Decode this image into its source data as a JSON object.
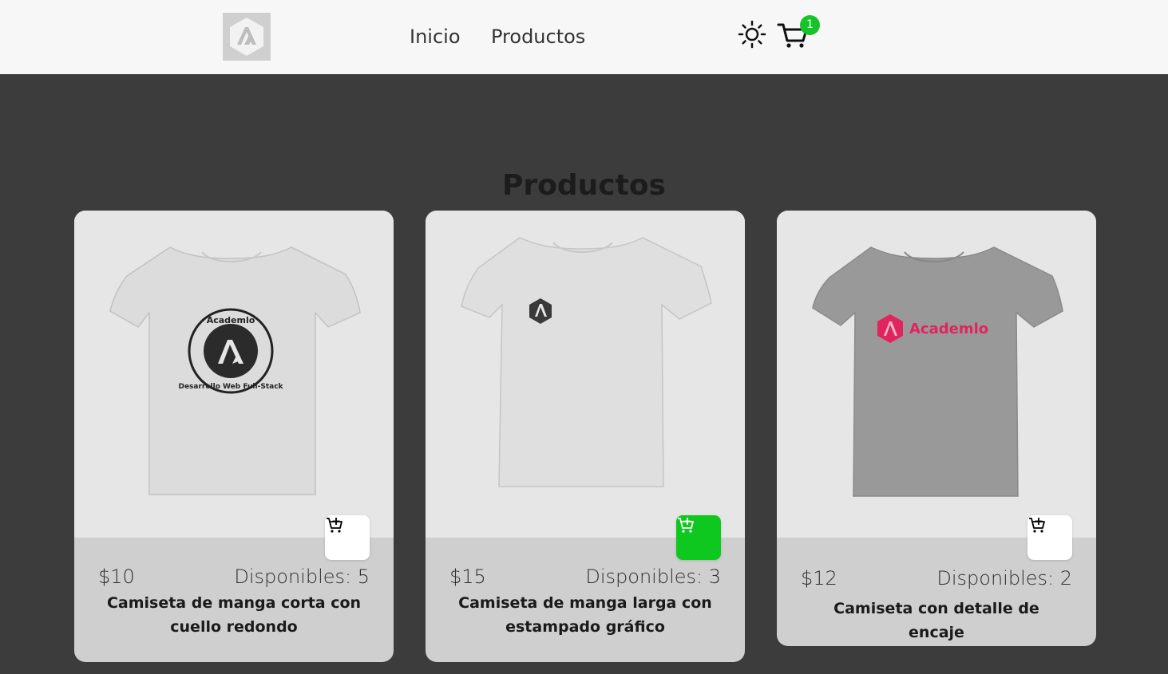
{
  "header": {
    "nav": [
      {
        "label": "Inicio"
      },
      {
        "label": "Productos"
      }
    ],
    "cart_count": "1",
    "icons": {
      "logo": "academlo-logo",
      "theme": "sun-icon",
      "cart": "cart-icon"
    }
  },
  "main": {
    "title": "Productos"
  },
  "products": [
    {
      "price": "$10",
      "stock": "Disponibles: 5",
      "name": "Camiseta de manga corta con cuello redondo",
      "shirt_color": "#dcdcdc",
      "in_cart": false
    },
    {
      "price": "$15",
      "stock": "Disponibles: 3",
      "name": "Camiseta de manga larga con estampado gráfico",
      "shirt_color": "#dfdfdf",
      "in_cart": true
    },
    {
      "price": "$12",
      "stock": "Disponibles: 2",
      "name": "Camiseta con detalle de encaje",
      "shirt_color": "#999999",
      "in_cart": false
    }
  ],
  "print_text": {
    "badge_top": "Academlo",
    "badge_bottom": "Desarrollo Web Full-Stack",
    "brand": "Academlo"
  },
  "colors": {
    "accent_green": "#16c42a",
    "brand_pink": "#e0245e",
    "background": "#3c3c3c",
    "header_bg": "#f7f7f7"
  }
}
